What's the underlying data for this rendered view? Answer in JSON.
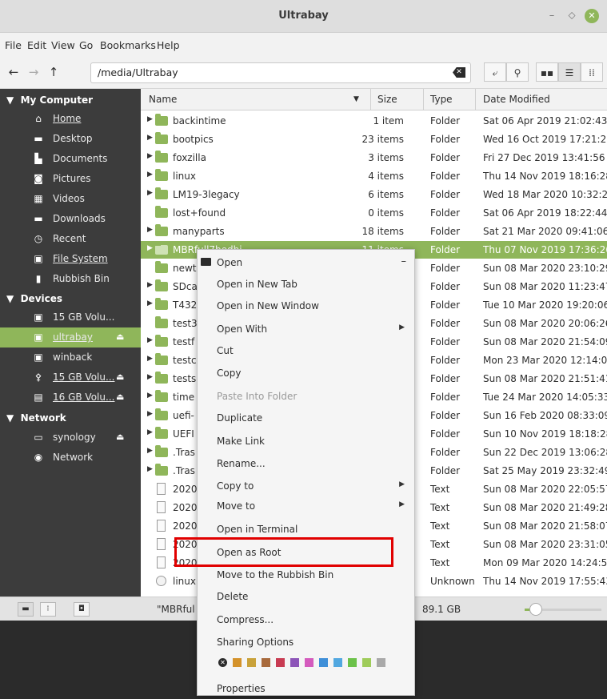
{
  "window": {
    "title": "Ultrabay",
    "controls": {
      "minimize": "–",
      "maximize": "⬦",
      "close": "✕"
    }
  },
  "menubar": [
    "File",
    "Edit",
    "View",
    "Go",
    "Bookmarks",
    "Help"
  ],
  "toolbar": {
    "back": "←",
    "forward": "→",
    "up": "↑",
    "path": "/media/Ultrabay",
    "clear": "✕",
    "buttons": [
      {
        "name": "toggle-location-button",
        "glyph": "⤶"
      },
      {
        "name": "search-button",
        "glyph": "⚲"
      },
      {
        "name": "icon-view-button",
        "glyph": "▪▪"
      },
      {
        "name": "list-view-button",
        "glyph": "☰"
      },
      {
        "name": "compact-view-button",
        "glyph": "⁞⁞"
      }
    ]
  },
  "sidebar": {
    "sections": [
      {
        "title": "My Computer",
        "items": [
          {
            "label": "Home",
            "icon": "home-icon"
          },
          {
            "label": "Desktop",
            "icon": "desktop-icon"
          },
          {
            "label": "Documents",
            "icon": "documents-icon"
          },
          {
            "label": "Pictures",
            "icon": "camera-icon"
          },
          {
            "label": "Videos",
            "icon": "film-icon"
          },
          {
            "label": "Downloads",
            "icon": "download-folder-icon"
          },
          {
            "label": "Recent",
            "icon": "clock-icon"
          },
          {
            "label": "File System",
            "icon": "drive-icon"
          },
          {
            "label": "Rubbish Bin",
            "icon": "trash-icon"
          }
        ]
      },
      {
        "title": "Devices",
        "items": [
          {
            "label": "15 GB Volu...",
            "icon": "drive-icon"
          },
          {
            "label": "ultrabay",
            "icon": "drive-icon"
          },
          {
            "label": "winback",
            "icon": "drive-icon"
          },
          {
            "label": "15 GB Volu...",
            "icon": "usb-icon"
          },
          {
            "label": "16 GB Volu...",
            "icon": "sdcard-icon"
          }
        ]
      },
      {
        "title": "Network",
        "items": [
          {
            "label": "synology",
            "icon": "network-drive-icon"
          },
          {
            "label": "Network",
            "icon": "network-icon"
          }
        ]
      }
    ]
  },
  "columns": {
    "name": "Name",
    "size": "Size",
    "type": "Type",
    "date": "Date Modified"
  },
  "files": [
    {
      "name": "backintime",
      "size": "1 item",
      "type": "Folder",
      "date": "Sat 06 Apr 2019 21:02:43 BS"
    },
    {
      "name": "bootpics",
      "size": "23 items",
      "type": "Folder",
      "date": "Wed 16 Oct 2019 17:21:22 B"
    },
    {
      "name": "foxzilla",
      "size": "3 items",
      "type": "Folder",
      "date": "Fri 27 Dec 2019 13:41:56 GM"
    },
    {
      "name": "linux",
      "size": "4 items",
      "type": "Folder",
      "date": "Thu 14 Nov 2019 18:16:28 G"
    },
    {
      "name": "LM19-3legacy",
      "size": "6 items",
      "type": "Folder",
      "date": "Wed 18 Mar 2020 10:32:25 G"
    },
    {
      "name": "lost+found",
      "size": "0 items",
      "type": "Folder",
      "date": "Sat 06 Apr 2019 18:22:44 BS"
    },
    {
      "name": "manyparts",
      "size": "18 items",
      "type": "Folder",
      "date": "Sat 21 Mar 2020 09:41:06 G"
    },
    {
      "name": "MBRfull7bedbi",
      "size": "11 items",
      "type": "Folder",
      "date": "Thu 07 Nov 2019 17:36:26 G"
    },
    {
      "name": "newt",
      "size": "",
      "type": "Folder",
      "date": "Sun 08 Mar 2020 23:10:29 G"
    },
    {
      "name": "SDca",
      "size": "",
      "type": "Folder",
      "date": "Sun 08 Mar 2020 11:23:47 G"
    },
    {
      "name": "T432",
      "size": "",
      "type": "Folder",
      "date": "Tue 10 Mar 2020 19:20:06 G"
    },
    {
      "name": "test3",
      "size": "",
      "type": "Folder",
      "date": "Sun 08 Mar 2020 20:06:26 G"
    },
    {
      "name": "testf",
      "size": "",
      "type": "Folder",
      "date": "Sun 08 Mar 2020 21:54:09 G"
    },
    {
      "name": "testc",
      "size": "",
      "type": "Folder",
      "date": "Mon 23 Mar 2020 12:14:02 G"
    },
    {
      "name": "tests",
      "size": "",
      "type": "Folder",
      "date": "Sun 08 Mar 2020 21:51:41 G"
    },
    {
      "name": "time",
      "size": "",
      "type": "Folder",
      "date": "Tue 24 Mar 2020 14:05:33 G"
    },
    {
      "name": "uefi-",
      "size": "",
      "type": "Folder",
      "date": "Sun 16 Feb 2020 08:33:09 G"
    },
    {
      "name": "UEFI",
      "size": "",
      "type": "Folder",
      "date": "Sun 10 Nov 2019 18:18:28 G"
    },
    {
      "name": ".Tras",
      "size": "",
      "type": "Folder",
      "date": "Sun 22 Dec 2019 13:06:28 G"
    },
    {
      "name": ".Tras",
      "size": "",
      "type": "Folder",
      "date": "Sat 25 May 2019 23:32:49 B"
    },
    {
      "name": "2020",
      "size": "",
      "type": "Text",
      "date": "Sun 08 Mar 2020 22:05:57 G"
    },
    {
      "name": "2020",
      "size": "",
      "type": "Text",
      "date": "Sun 08 Mar 2020 21:49:28 G"
    },
    {
      "name": "2020",
      "size": "",
      "type": "Text",
      "date": "Sun 08 Mar 2020 21:58:07 G"
    },
    {
      "name": "2020",
      "size": "",
      "type": "Text",
      "date": "Sun 08 Mar 2020 23:31:05 G"
    },
    {
      "name": "2020",
      "size": "",
      "type": "Text",
      "date": "Mon 09 Mar 2020 14:24:55 G"
    },
    {
      "name": "linux",
      "size": "",
      "type": "Unknown",
      "date": "Thu 14 Nov 2019 17:55:43 G"
    }
  ],
  "status": {
    "text": "\"MBRful",
    "free": "89.1 GB"
  },
  "context_menu": {
    "items": [
      {
        "label": "Open",
        "icon": "folder-icon",
        "extra": "–"
      },
      {
        "label": "Open in New Tab"
      },
      {
        "label": "Open in New Window"
      },
      {
        "label": "Open With",
        "submenu": true
      },
      {
        "label": "Cut"
      },
      {
        "label": "Copy"
      },
      {
        "label": "Paste Into Folder",
        "disabled": true
      },
      {
        "label": "Duplicate"
      },
      {
        "label": "Make Link"
      },
      {
        "label": "Rename..."
      },
      {
        "label": "Copy to",
        "submenu": true
      },
      {
        "label": "Move to",
        "submenu": true
      },
      {
        "label": "Open in Terminal"
      },
      {
        "label": "Open as Root"
      },
      {
        "label": "Move to the Rubbish Bin"
      },
      {
        "label": "Delete"
      },
      {
        "label": "Compress..."
      },
      {
        "label": "Sharing Options"
      },
      {
        "label": "Properties"
      }
    ],
    "emblem_colors": [
      "#d4922a",
      "#c9a23a",
      "#a86a3c",
      "#c83b52",
      "#8d55b8",
      "#d45bbd",
      "#3f8fd8",
      "#52a8e0",
      "#6cc24a",
      "#9fcc5a",
      "#a9a9a9"
    ]
  },
  "accent": "#8fb65a",
  "highlight_color": "#e10000"
}
